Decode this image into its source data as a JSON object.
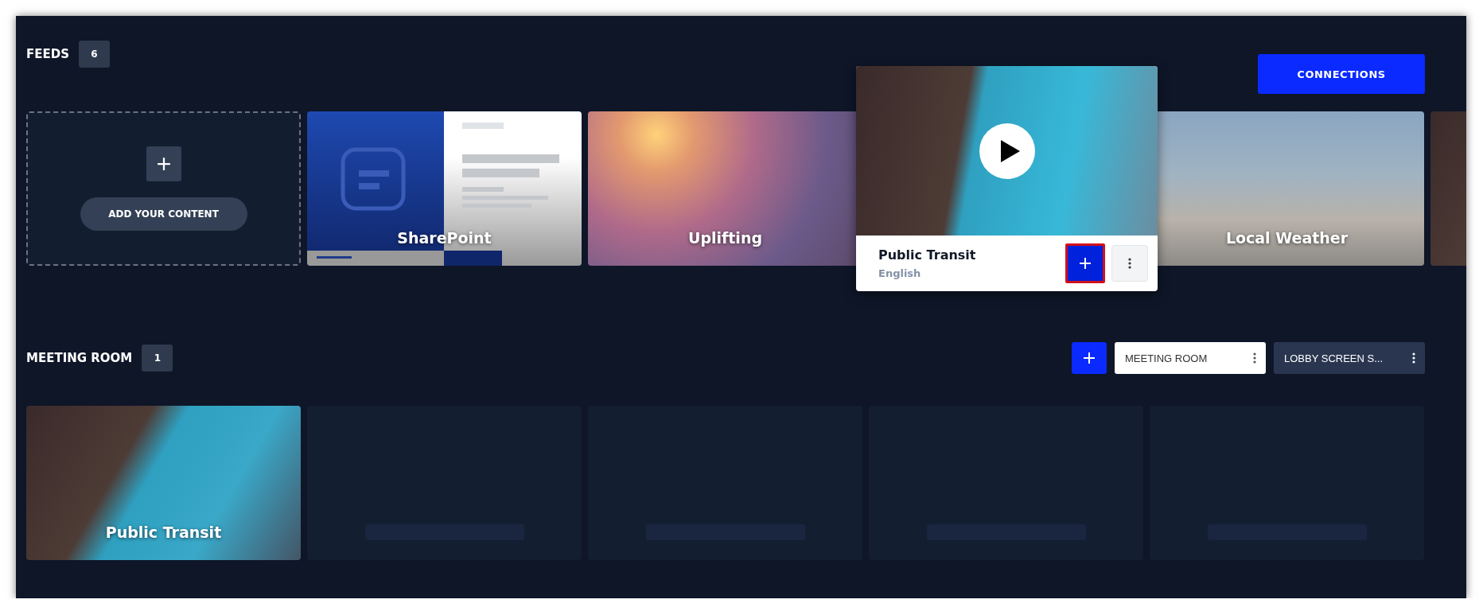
{
  "feeds": {
    "title": "FEEDS",
    "count": "6",
    "connections_button": "CONNECTIONS",
    "items": [
      {
        "kind": "add",
        "label": "ADD YOUR CONTENT"
      },
      {
        "kind": "document",
        "title": "SharePoint"
      },
      {
        "kind": "photo",
        "title": "Uplifting"
      },
      {
        "kind": "photo",
        "title": "Public Transit",
        "subtitle": "English",
        "expanded": true
      },
      {
        "kind": "photo",
        "title": "Local Weather"
      },
      {
        "kind": "photo"
      }
    ]
  },
  "meeting_room": {
    "title": "MEETING ROOM",
    "count": "1",
    "tabs": [
      {
        "label": "MEETING ROOM",
        "selected": true
      },
      {
        "label": "LOBBY SCREEN S...",
        "selected": false
      }
    ],
    "slots": [
      {
        "kind": "photo",
        "title": "Public Transit"
      },
      {
        "kind": "empty"
      },
      {
        "kind": "empty"
      },
      {
        "kind": "empty"
      },
      {
        "kind": "empty"
      }
    ]
  }
}
